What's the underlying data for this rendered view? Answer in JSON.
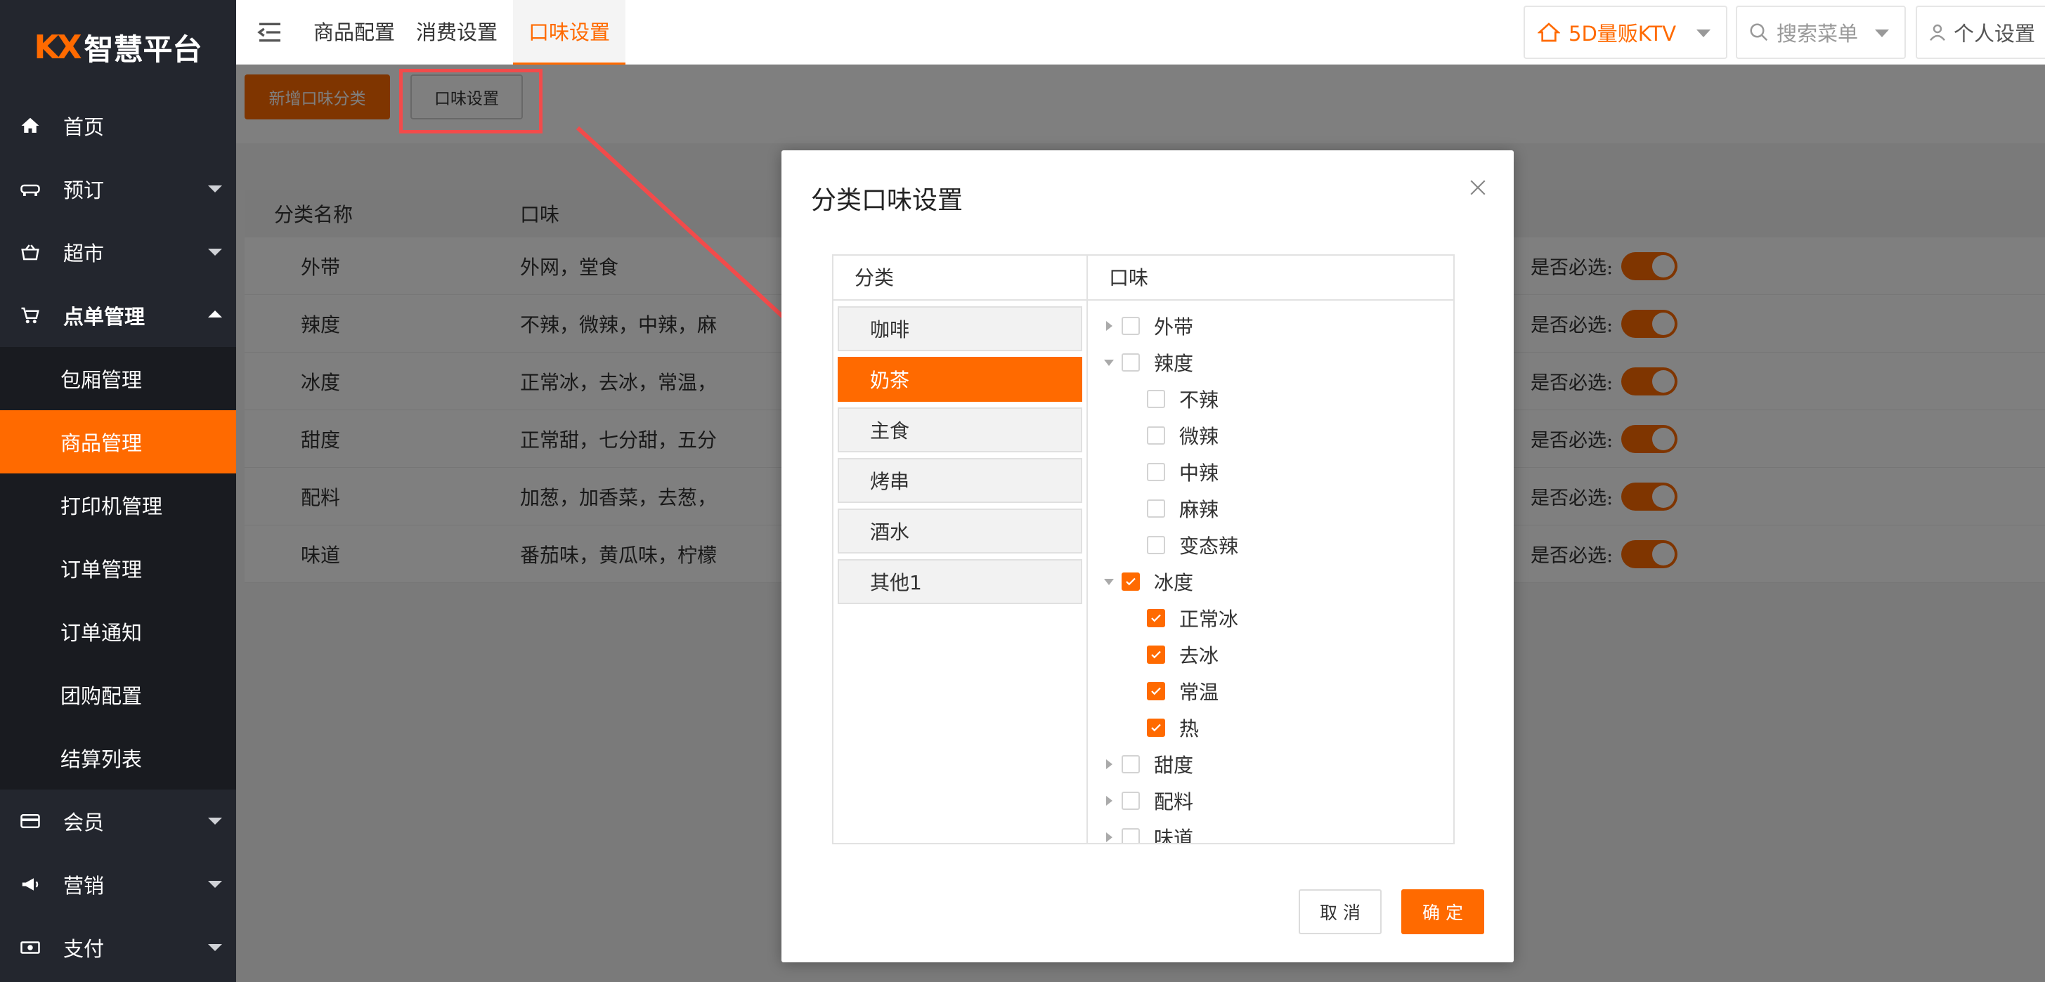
{
  "brand": {
    "mark": "KX",
    "name": "智慧平台"
  },
  "colors": {
    "accent": "#ff6a00",
    "sidebar_bg": "#23262e",
    "submenu_bg": "#191b20",
    "annotation": "#f24b4b"
  },
  "sidebar": {
    "items": [
      {
        "label": "首页",
        "icon": "home-icon"
      },
      {
        "label": "预订",
        "icon": "bed-icon"
      },
      {
        "label": "超市",
        "icon": "basket-icon"
      },
      {
        "label": "点单管理",
        "icon": "cart-icon",
        "expanded": true
      },
      {
        "label": "会员",
        "icon": "card-icon"
      },
      {
        "label": "营销",
        "icon": "megaphone-icon"
      },
      {
        "label": "支付",
        "icon": "money-icon"
      }
    ],
    "submenu": [
      "包厢管理",
      "商品管理",
      "打印机管理",
      "订单管理",
      "订单通知",
      "团购配置",
      "结算列表"
    ],
    "active_submenu": "商品管理"
  },
  "topbar": {
    "tabs": [
      "商品配置",
      "消费设置",
      "口味设置"
    ],
    "active_tab": "口味设置",
    "store": "5D量贩KTV",
    "search_placeholder": "搜索菜单",
    "personal": "个人设置"
  },
  "actions": {
    "add_category": "新增口味分类",
    "taste_settings": "口味设置"
  },
  "table": {
    "headers": [
      "分类名称",
      "口味"
    ],
    "required_label": "是否必选:",
    "rows": [
      {
        "name": "外带",
        "tastes": "外网，堂食"
      },
      {
        "name": "辣度",
        "tastes": "不辣，微辣，中辣，麻"
      },
      {
        "name": "冰度",
        "tastes": "正常冰，去冰，常温，"
      },
      {
        "name": "甜度",
        "tastes": "正常甜，七分甜，五分"
      },
      {
        "name": "配料",
        "tastes": "加葱，加香菜，去葱，"
      },
      {
        "name": "味道",
        "tastes": "番茄味，黄瓜味，柠檬"
      }
    ]
  },
  "modal": {
    "title": "分类口味设置",
    "category_header": "分类",
    "taste_header": "口味",
    "categories": [
      "咖啡",
      "奶茶",
      "主食",
      "烤串",
      "酒水",
      "其他1"
    ],
    "selected_category": "奶茶",
    "tree": [
      {
        "label": "外带",
        "expanded": false,
        "checked": false,
        "children": []
      },
      {
        "label": "辣度",
        "expanded": true,
        "checked": false,
        "children": [
          {
            "label": "不辣",
            "checked": false
          },
          {
            "label": "微辣",
            "checked": false
          },
          {
            "label": "中辣",
            "checked": false
          },
          {
            "label": "麻辣",
            "checked": false
          },
          {
            "label": "变态辣",
            "checked": false
          }
        ]
      },
      {
        "label": "冰度",
        "expanded": true,
        "checked": true,
        "children": [
          {
            "label": "正常冰",
            "checked": true
          },
          {
            "label": "去冰",
            "checked": true
          },
          {
            "label": "常温",
            "checked": true
          },
          {
            "label": "热",
            "checked": true
          }
        ]
      },
      {
        "label": "甜度",
        "expanded": false,
        "checked": false,
        "children": []
      },
      {
        "label": "配料",
        "expanded": false,
        "checked": false,
        "children": []
      },
      {
        "label": "味道",
        "expanded": false,
        "checked": false,
        "children": []
      }
    ],
    "cancel": "取 消",
    "ok": "确 定"
  }
}
